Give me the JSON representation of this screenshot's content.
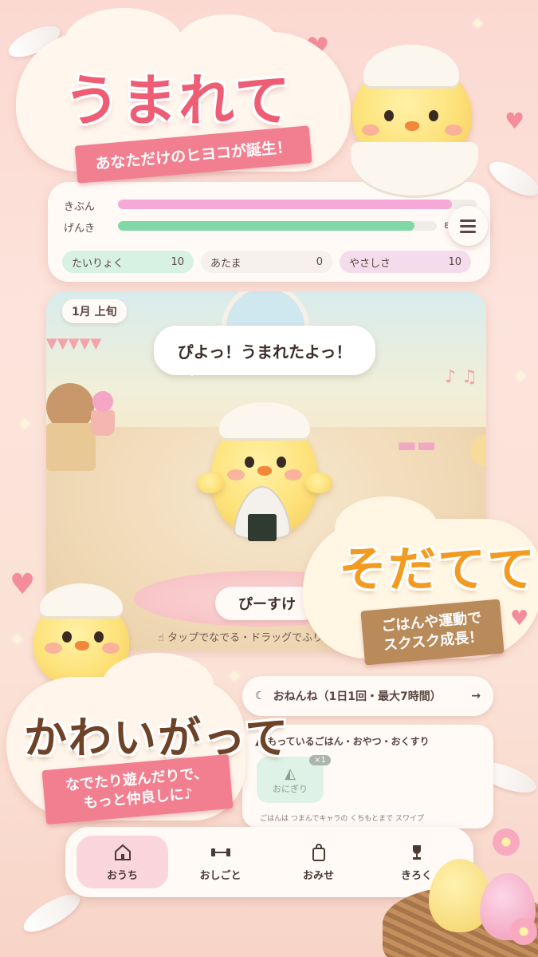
{
  "top_banner": {
    "title": "うまれて",
    "subtitle": "あなただけのヒヨコが誕生！"
  },
  "stats": {
    "mood_label": "きぶん",
    "mood_level": 0.93,
    "energy_label": "げんき",
    "energy_level": 0.93,
    "energy_value": "ε",
    "chips": [
      {
        "label": "たいりょく",
        "value": "10",
        "color": "#d7f1e2"
      },
      {
        "label": "あたま",
        "value": "0",
        "color": "#f6f1ec"
      },
      {
        "label": "やさしさ",
        "value": "10",
        "color": "#f4dcec"
      }
    ]
  },
  "room": {
    "date": "1月 上旬",
    "speech": "ぴよっ！うまれたよっ！",
    "chick_name": "ぴーすけ",
    "hint": "タップでなでる・ドラッグでふりふ"
  },
  "right_banner": {
    "title": "そだてて",
    "subtitle_line1": "ごはんや運動で",
    "subtitle_line2": "スクスク成長！"
  },
  "sleep": {
    "label": "おねんね（1日1回・最大7時間）",
    "arrow": "→"
  },
  "items": {
    "title": "もっているごはん・おやつ・おくすり",
    "item_name": "おにぎり",
    "item_count": "×1",
    "hint": "ごはんは つまんでキャラの くちもとまで スワイプ"
  },
  "left_banner": {
    "title": "かわいがって",
    "subtitle_line1": "なでたり遊んだりで、",
    "subtitle_line2": "もっと仲良しに♪"
  },
  "nav": {
    "items": [
      {
        "label": "おうち",
        "icon": "home-icon"
      },
      {
        "label": "おしごと",
        "icon": "dumbbell-icon"
      },
      {
        "label": "おみせ",
        "icon": "shopping-bag-icon"
      },
      {
        "label": "きろく",
        "icon": "trophy-icon"
      }
    ],
    "active": "おうち"
  },
  "colors": {
    "accent_pink": "#ef5d74",
    "accent_orange": "#f29b20",
    "accent_brown": "#6d4227",
    "mood_bar": "#f4a9d8",
    "energy_bar": "#7fd8a6"
  }
}
